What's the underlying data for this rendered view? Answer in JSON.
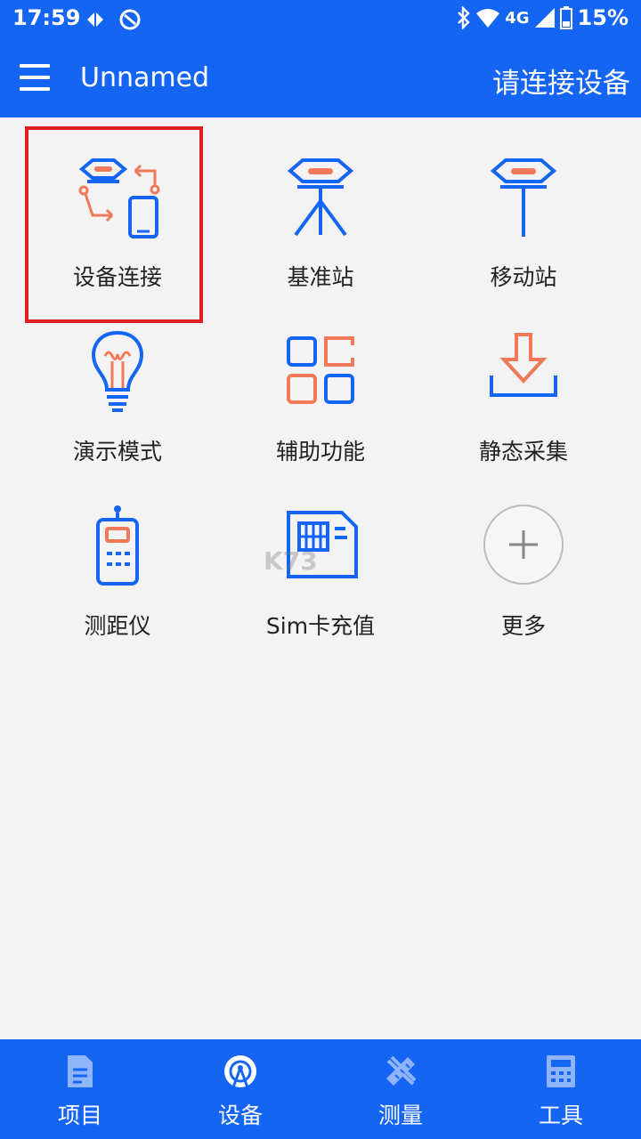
{
  "status_bar": {
    "time": "17:59",
    "network": "4G",
    "battery": "15%"
  },
  "app_bar": {
    "title": "Unnamed",
    "action": "请连接设备"
  },
  "menu": [
    {
      "label": "设备连接",
      "icon": "device-connect-icon"
    },
    {
      "label": "基准站",
      "icon": "base-station-icon"
    },
    {
      "label": "移动站",
      "icon": "rover-station-icon"
    },
    {
      "label": "演示模式",
      "icon": "lightbulb-icon"
    },
    {
      "label": "辅助功能",
      "icon": "grid-icon"
    },
    {
      "label": "静态采集",
      "icon": "download-icon"
    },
    {
      "label": "测距仪",
      "icon": "rangefinder-icon"
    },
    {
      "label": "Sim卡充值",
      "icon": "sim-card-icon"
    },
    {
      "label": "更多",
      "icon": "plus-icon"
    }
  ],
  "bottom_nav": [
    {
      "label": "项目",
      "icon": "document-icon"
    },
    {
      "label": "设备",
      "icon": "antenna-icon"
    },
    {
      "label": "测量",
      "icon": "ruler-pencil-icon"
    },
    {
      "label": "工具",
      "icon": "calculator-icon"
    }
  ],
  "watermark": "K73",
  "colors": {
    "primary": "#1565f5",
    "accent": "#f07a58",
    "highlight": "#e02020"
  }
}
